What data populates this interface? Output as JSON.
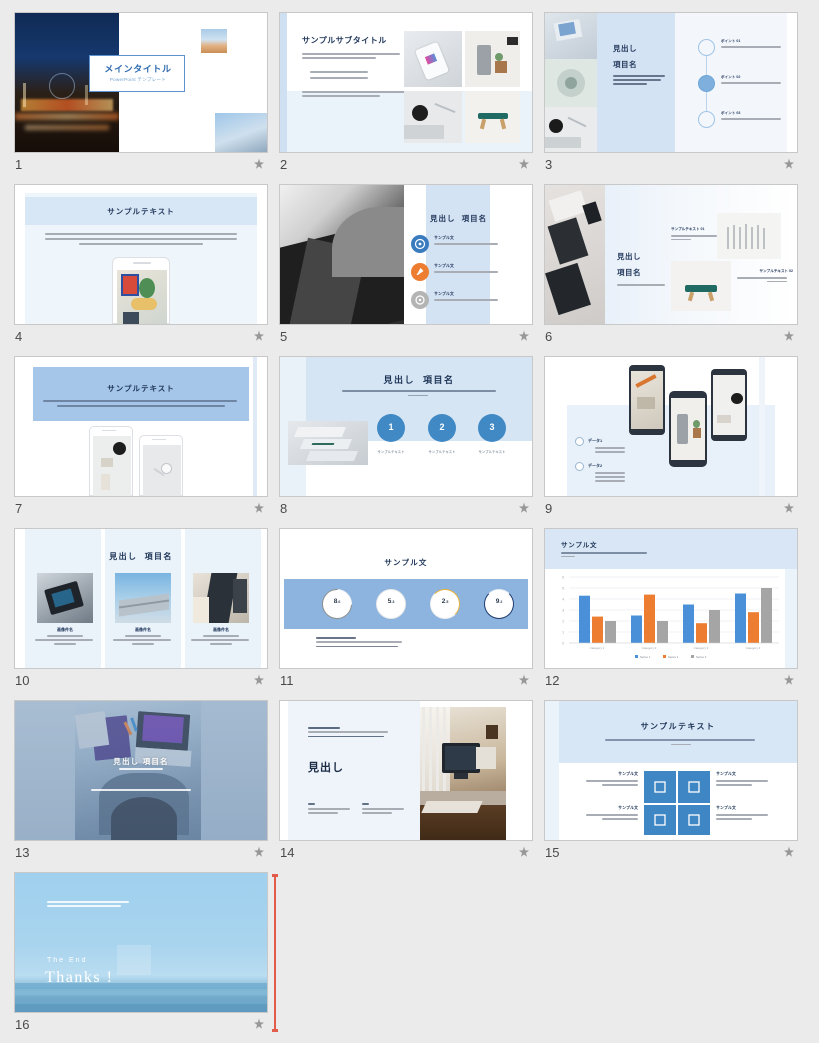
{
  "app": {
    "view": "slide-sorter",
    "total_slides": 16,
    "background_color": "#ebebeb",
    "accent_blue": "#8cb4de",
    "accent_deep_blue": "#3a7bbf",
    "accent_orange": "#ed7d31",
    "accent_gray": "#a5a5a5",
    "scroll_indicator_color": "#e35b4a"
  },
  "star_icon": "star-icon",
  "slides": [
    {
      "number": "1",
      "name": "title-slide",
      "title": "メインタイトル",
      "subtitle": "PowerPoint テンプレート",
      "photos": [
        "night-city-highway",
        "beach-strip",
        "building-sky"
      ]
    },
    {
      "number": "2",
      "name": "subtitle-photo-grid-slide",
      "title": "サンプルサブタイトル",
      "body": "ここをクリックまたはタップしてテキストを入力してください。",
      "bullets": [
        "サンプルテキスト",
        "サンプルテキスト"
      ],
      "footnote": "TEMPLATE DESIGNED BY WONDERSHARE",
      "photos": [
        "smartphone-hand",
        "air-purifier-room",
        "coffee-keyboard-desk",
        "green-bench"
      ]
    },
    {
      "number": "3",
      "name": "timeline-slide",
      "heading_1": "見出し",
      "heading_2": "項目名",
      "body": "項目に関する説明をお入れください。ここをクリックまたはタップしてテキストを入力してください。",
      "timeline": [
        {
          "label": "ポイント 01",
          "text": "ここをクリックまたはタップしてテキストを入力してください。"
        },
        {
          "label": "ポイント 02",
          "text": "ここをクリックまたはタップしてテキストを入力してください。"
        },
        {
          "label": "ポイント 03",
          "text": "ここをクリックまたはタップしてテキストを入力してください。"
        }
      ],
      "photos": [
        "hand-notebook",
        "ceramic-bowl",
        "coffee-keyboard"
      ]
    },
    {
      "number": "4",
      "name": "sample-text-phone-slide",
      "title": "サンプルテキスト",
      "body": "サンプルテキスト。ここをクリックまたはタップしてテキストを入力してください。TEMPLATE DESIGNED BY WONDERSHARE サンプルテキスト。ここをクリックまたはタップしてテキストを入力してください。",
      "photos": [
        "phone-mockup-food"
      ]
    },
    {
      "number": "5",
      "name": "icon-list-slide",
      "heading_1": "見出し",
      "heading_2": "項目名",
      "items": [
        {
          "label": "サンプル文",
          "text": "項目に関する説明をお入れください。",
          "icon": "target-icon",
          "color": "#3a7bbf"
        },
        {
          "label": "サンプル文",
          "text": "項目に関する説明をお入れください。",
          "icon": "rocket-icon",
          "color": "#ed7d31"
        },
        {
          "label": "サンプル文",
          "text": "項目に関する説明をお入れください。",
          "icon": "gear-icon",
          "color": "#a5a5a5"
        }
      ],
      "photos": [
        "architecture-bw"
      ]
    },
    {
      "number": "6",
      "name": "heading-photo-pair-slide",
      "heading_1": "見出し",
      "heading_2": "項目名",
      "body": "項目に関する説明をお入れください。",
      "items": [
        {
          "label": "サンプルテキスト 01",
          "text": "項目に関する説明をお入れください。"
        },
        {
          "label": "サンプルテキスト 02",
          "text": "項目に関する説明をお入れください。"
        }
      ],
      "photos": [
        "desk-devices",
        "white-brushes",
        "green-case"
      ]
    },
    {
      "number": "7",
      "name": "banner-text-phones-slide",
      "title": "サンプルテキスト",
      "body": "サンプルテキスト。ここをクリックまたはタップしてテキストを入力してください。TEMPLATE DESIGNED BY WONDERSHARE サンプルテキスト。ここをクリックまたはタップしてテキストを入力してください。",
      "photos": [
        "phone-mockup-camera",
        "phone-mockup-earphone"
      ]
    },
    {
      "number": "8",
      "name": "numbered-steps-slide",
      "heading_1": "見出し",
      "heading_2": "項目名",
      "body": "ここを選択して、テキストの追加をお願いしてください。",
      "steps": [
        {
          "number": "1",
          "caption": "サンプルテキスト"
        },
        {
          "number": "2",
          "caption": "サンプルテキスト"
        },
        {
          "number": "3",
          "caption": "サンプルテキスト"
        }
      ],
      "photos": [
        "stacked-laptops"
      ]
    },
    {
      "number": "9",
      "name": "phones-data-list-slide",
      "groups": [
        {
          "label": "データ1",
          "items": [
            "サンプルテキスト",
            "サンプルテキスト"
          ]
        },
        {
          "label": "データ2",
          "items": [
            "サンプルテキスト",
            "サンプルテキスト",
            "サンプルテキスト"
          ]
        }
      ],
      "photos": [
        "phone-desk-top",
        "phone-purifier",
        "phone-camera-shelf"
      ]
    },
    {
      "number": "10",
      "name": "three-photo-cards-slide",
      "heading_1": "見出し",
      "heading_2": "項目名",
      "cards": [
        {
          "label": "画像件名",
          "text": "サンプルテキスト。ここを選択してテキストを入力してください。"
        },
        {
          "label": "画像件名",
          "text": "サンプルテキスト。ここを選択してテキストを入力してください。"
        },
        {
          "label": "画像件名",
          "text": "サンプルテキスト。ここを選択してテキストを入力してください。"
        }
      ],
      "photos": [
        "calculator-dark",
        "building-sky",
        "glass-tower"
      ]
    },
    {
      "number": "11",
      "name": "donut-stats-slide",
      "title": "サンプル文",
      "body": "サンプルテキスト。ここを選択して、テキストの追加をお願いしてください。TEMPLATE DESIGNED BY WONDERSHARE",
      "stats": [
        {
          "value": "8",
          "decimal": "6",
          "ring_color": "#8f8f8f",
          "percent": 72
        },
        {
          "value": "5",
          "decimal": "3",
          "ring_color": "#e8e8e8",
          "percent": 12
        },
        {
          "value": "2",
          "decimal": "5",
          "ring_color": "#e8b33c",
          "percent": 30
        },
        {
          "value": "9",
          "decimal": "2",
          "ring_color": "#1f3c6e",
          "percent": 88
        }
      ]
    },
    {
      "number": "12",
      "name": "bar-chart-slide",
      "title": "サンプル文",
      "body": "ここをクリックまたはタップしてください。",
      "chart_data": {
        "type": "bar",
        "title": "サンプル文",
        "categories": [
          "Category 1",
          "Category 2",
          "Category 3",
          "Category 4"
        ],
        "series": [
          {
            "name": "Series 1",
            "color": "#4a90d9",
            "values": [
              4.3,
              2.5,
              3.5,
              4.5
            ]
          },
          {
            "name": "Series 2",
            "color": "#ed7d31",
            "values": [
              2.4,
              4.4,
              1.8,
              2.8
            ]
          },
          {
            "name": "Series 3",
            "color": "#a5a5a5",
            "values": [
              2.0,
              2.0,
              3.0,
              5.0
            ]
          }
        ],
        "ylim": [
          0,
          6
        ],
        "yticks": [
          0,
          1,
          2,
          3,
          4,
          5,
          6
        ],
        "xlabel": "",
        "ylabel": "",
        "grid": true,
        "legend_position": "bottom"
      }
    },
    {
      "number": "13",
      "name": "full-photo-heading-slide",
      "heading": "見出し 項目名",
      "subheading": "サンプルテキスト",
      "body": "ここをクリックまたはタップしてください。",
      "photos": [
        "laptop-notebook-overhead"
      ]
    },
    {
      "number": "14",
      "name": "text-photo-split-slide",
      "eyebrow": "サンプルテキスト",
      "lead": "ここを選択して、テキストの追加をお願いしてください。",
      "footnote": "TEMPLATE DESIGNED BY WONDERSHARE",
      "heading": "見出し",
      "columns": [
        {
          "label": "01",
          "text": "ここを選択してテキストの追加をお願いします。"
        },
        {
          "label": "02",
          "text": "ここを選択してテキストの追加をお願いします。"
        }
      ],
      "photos": [
        "imac-wooden-desk"
      ]
    },
    {
      "number": "15",
      "name": "four-icon-grid-slide",
      "title": "サンプルテキスト",
      "body": "ここをクリックまたはタップしてください。",
      "items": [
        {
          "label": "サンプル文",
          "text": "項目に関する説明をお入れください。",
          "icon": "square-icon"
        },
        {
          "label": "サンプル文",
          "text": "項目に関する説明をお入れください。",
          "icon": "square-icon"
        },
        {
          "label": "サンプル文",
          "text": "項目に関する説明をお入れください。",
          "icon": "square-icon"
        },
        {
          "label": "サンプル文",
          "text": "項目に関する説明をお入れください。",
          "icon": "square-icon"
        }
      ]
    },
    {
      "number": "16",
      "name": "thanks-closing-slide",
      "body": "ここをクリックまたはタップしてください。",
      "footnote": "TEMPLATE DESIGNED BY WONDERSHARE",
      "kicker": "The End",
      "title": "Thanks !",
      "photos": [
        "sky-sea-horizon"
      ]
    }
  ]
}
